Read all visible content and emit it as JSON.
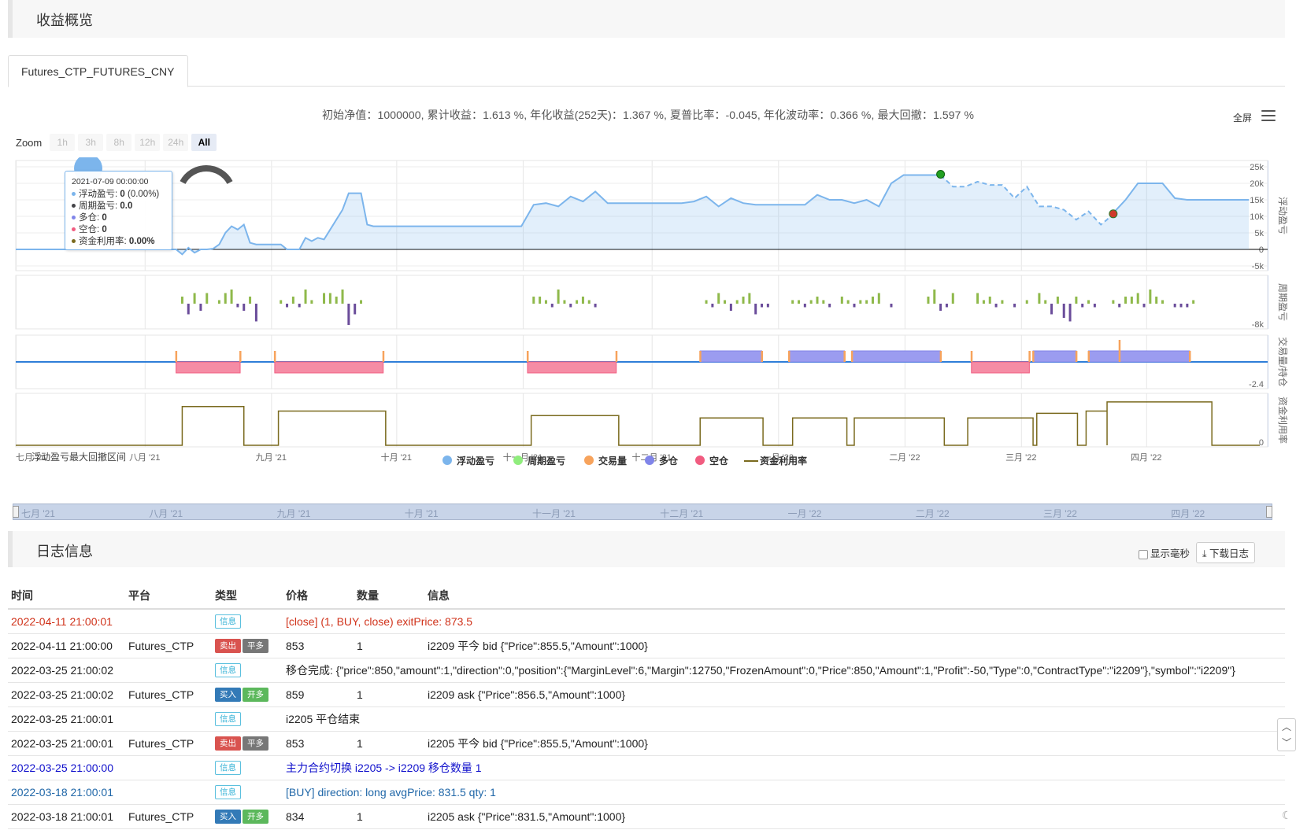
{
  "sections": {
    "overview_title": "收益概览",
    "log_title": "日志信息"
  },
  "tab": {
    "label": "Futures_CTP_FUTURES_CNY"
  },
  "summary_text": "初始净值：1000000, 累计收益：1.613 %, 年化收益(252天)：1.367 %, 夏普比率：-0.045, 年化波动率：0.366 %, 最大回撤：1.597 %",
  "toolbar": {
    "fullscreen": "全屏",
    "menu_icon": "hamburger-menu-icon"
  },
  "zoom": {
    "label": "Zoom",
    "buttons": [
      "1h",
      "3h",
      "8h",
      "12h",
      "24h",
      "All"
    ],
    "active": "All"
  },
  "tooltip": {
    "date": "2021-07-09 00:00:00",
    "rows": [
      {
        "label": "浮动盈亏: ",
        "value": "0",
        "extra": " (0.00%)",
        "color": "#7cb5ec"
      },
      {
        "label": "周期盈亏: ",
        "value": "0.0",
        "extra": "",
        "color": "#434348"
      },
      {
        "label": "多仓: ",
        "value": "0",
        "extra": "",
        "color": "#8085e9"
      },
      {
        "label": "空仓: ",
        "value": "0",
        "extra": "",
        "color": "#f15c80"
      },
      {
        "label": "资金利用率: ",
        "value": "0.00%",
        "extra": "",
        "color": "#7a6a1e"
      }
    ]
  },
  "chart_data": {
    "type": "line",
    "x_labels": [
      "七月 '21",
      "八月 '21",
      "九月 '21",
      "十月 '21",
      "十一月 '21",
      "十二月 '21",
      "一月 '22",
      "二月 '22",
      "三月 '22",
      "四月 '22"
    ],
    "annotation": "浮动盈亏最大回撤区间",
    "panels": [
      {
        "name": "浮动盈亏",
        "y_ticks": [
          "25k",
          "20k",
          "15k",
          "10k",
          "5k",
          "0",
          "-5k"
        ],
        "ylim": [
          -5000,
          25000
        ]
      },
      {
        "name": "周期盈亏",
        "y_ticks": [
          "-8k"
        ]
      },
      {
        "name": "交易量/持仓",
        "y_ticks": [
          "-2.4"
        ]
      },
      {
        "name": "资金利用率",
        "y_ticks": [
          "0"
        ]
      }
    ],
    "series_floating": {
      "name": "浮动盈亏",
      "x_frac": [
        0,
        0.13,
        0.135,
        0.14,
        0.145,
        0.15,
        0.155,
        0.16,
        0.165,
        0.17,
        0.175,
        0.18,
        0.185,
        0.19,
        0.195,
        0.2,
        0.205,
        0.21,
        0.215,
        0.22,
        0.225,
        0.23,
        0.235,
        0.24,
        0.245,
        0.25,
        0.255,
        0.26,
        0.265,
        0.27,
        0.275,
        0.28,
        0.285,
        0.29,
        0.3,
        0.31,
        0.32,
        0.33,
        0.34,
        0.35,
        0.36,
        0.37,
        0.38,
        0.39,
        0.4,
        0.41,
        0.42,
        0.43,
        0.44,
        0.45,
        0.46,
        0.47,
        0.48,
        0.49,
        0.5,
        0.51,
        0.52,
        0.53,
        0.54,
        0.55,
        0.56,
        0.57,
        0.58,
        0.59,
        0.6,
        0.61,
        0.62,
        0.63,
        0.64,
        0.65,
        0.66,
        0.67,
        0.68,
        0.69,
        0.7,
        0.71,
        0.72,
        0.73,
        0.74,
        0.75,
        0.76,
        0.77,
        0.78,
        0.79,
        0.8,
        0.81,
        0.82,
        0.83,
        0.84,
        0.85,
        0.86,
        0.87,
        0.88,
        0.885,
        0.89,
        0.9,
        0.91,
        0.92,
        0.93,
        0.94,
        0.95,
        0.96,
        0.97,
        0.98,
        0.99,
        1.0
      ],
      "y": [
        0,
        0,
        -1500,
        500,
        -1000,
        0,
        0,
        200,
        1500,
        5000,
        7000,
        6000,
        7500,
        2000,
        1500,
        1500,
        1500,
        1500,
        1500,
        0,
        0,
        0,
        3500,
        2500,
        3500,
        3000,
        6000,
        9000,
        12000,
        17000,
        17000,
        17000,
        7500,
        7000,
        7000,
        7000,
        7000,
        7000,
        7000,
        7000,
        7000,
        7000,
        7000,
        7000,
        7000,
        7000,
        13500,
        14000,
        13000,
        16000,
        14500,
        17500,
        14000,
        14000,
        14000,
        14000,
        14000,
        14000,
        14000,
        14500,
        16000,
        13000,
        15500,
        14000,
        13500,
        13500,
        13500,
        13500,
        13500,
        16500,
        15000,
        15000,
        14000,
        15000,
        13000,
        20000,
        22500,
        22500,
        22500,
        22500,
        19000,
        19000,
        20500,
        19500,
        19500,
        15500,
        19000,
        13000,
        13000,
        12000,
        9000,
        11500,
        7500,
        9000,
        11000,
        15000,
        20000,
        20000,
        20000,
        15500,
        15000,
        15000,
        15000,
        15000,
        15000,
        15000
      ],
      "dashed_from": 0.75,
      "dashed_to": 0.89,
      "max_marker": 0.745,
      "min_marker": 0.89
    },
    "series_period": {
      "name": "周期盈亏",
      "bars": [
        [
          0.135,
          2
        ],
        [
          0.14,
          -3
        ],
        [
          0.145,
          3
        ],
        [
          0.15,
          -2
        ],
        [
          0.155,
          3
        ],
        [
          0.165,
          1
        ],
        [
          0.17,
          3
        ],
        [
          0.175,
          4
        ],
        [
          0.18,
          -1
        ],
        [
          0.185,
          -2
        ],
        [
          0.19,
          2
        ],
        [
          0.195,
          -5
        ],
        [
          0.215,
          1
        ],
        [
          0.22,
          -1
        ],
        [
          0.225,
          2
        ],
        [
          0.23,
          -1
        ],
        [
          0.235,
          4
        ],
        [
          0.24,
          1
        ],
        [
          0.25,
          3
        ],
        [
          0.255,
          3
        ],
        [
          0.26,
          2
        ],
        [
          0.265,
          4
        ],
        [
          0.27,
          -6
        ],
        [
          0.275,
          -3
        ],
        [
          0.28,
          1
        ],
        [
          0.42,
          2
        ],
        [
          0.425,
          2
        ],
        [
          0.43,
          1
        ],
        [
          0.435,
          -1
        ],
        [
          0.44,
          4
        ],
        [
          0.445,
          1
        ],
        [
          0.45,
          -1
        ],
        [
          0.455,
          1
        ],
        [
          0.46,
          2
        ],
        [
          0.465,
          1
        ],
        [
          0.47,
          -1
        ],
        [
          0.56,
          1
        ],
        [
          0.565,
          -1
        ],
        [
          0.57,
          3
        ],
        [
          0.575,
          1
        ],
        [
          0.58,
          -2
        ],
        [
          0.585,
          1
        ],
        [
          0.59,
          2
        ],
        [
          0.595,
          3
        ],
        [
          0.6,
          -3
        ],
        [
          0.605,
          -1
        ],
        [
          0.61,
          -1
        ],
        [
          0.63,
          1
        ],
        [
          0.635,
          1
        ],
        [
          0.64,
          -1
        ],
        [
          0.645,
          1
        ],
        [
          0.65,
          2
        ],
        [
          0.655,
          1
        ],
        [
          0.66,
          -1
        ],
        [
          0.67,
          2
        ],
        [
          0.675,
          1
        ],
        [
          0.68,
          -1
        ],
        [
          0.685,
          1
        ],
        [
          0.69,
          1
        ],
        [
          0.695,
          2
        ],
        [
          0.7,
          3
        ],
        [
          0.71,
          -1
        ],
        [
          0.74,
          2
        ],
        [
          0.745,
          4
        ],
        [
          0.75,
          -2
        ],
        [
          0.755,
          -1
        ],
        [
          0.76,
          3
        ],
        [
          0.78,
          3
        ],
        [
          0.785,
          1
        ],
        [
          0.79,
          2
        ],
        [
          0.795,
          -1
        ],
        [
          0.8,
          1
        ],
        [
          0.81,
          -1
        ],
        [
          0.82,
          1
        ],
        [
          0.83,
          3
        ],
        [
          0.835,
          1
        ],
        [
          0.84,
          -3
        ],
        [
          0.845,
          2
        ],
        [
          0.85,
          -4
        ],
        [
          0.855,
          -5
        ],
        [
          0.86,
          2
        ],
        [
          0.865,
          -1
        ],
        [
          0.87,
          1
        ],
        [
          0.875,
          -1
        ],
        [
          0.89,
          1
        ],
        [
          0.895,
          -1
        ],
        [
          0.9,
          2
        ],
        [
          0.905,
          2
        ],
        [
          0.91,
          3
        ],
        [
          0.915,
          -1
        ],
        [
          0.92,
          4
        ],
        [
          0.925,
          2
        ],
        [
          0.93,
          1
        ],
        [
          0.94,
          -1
        ],
        [
          0.945,
          -1
        ],
        [
          0.95,
          -1
        ],
        [
          0.955,
          1
        ]
      ]
    },
    "series_position": {
      "long": [
        [
          0.555,
          0.605
        ],
        [
          0.627,
          0.672
        ],
        [
          0.678,
          0.75
        ],
        [
          0.825,
          0.86
        ],
        [
          0.87,
          0.952
        ]
      ],
      "short": [
        [
          0.13,
          0.182
        ],
        [
          0.21,
          0.298
        ],
        [
          0.415,
          0.487
        ],
        [
          0.775,
          0.822
        ]
      ],
      "trades": [
        0.13,
        0.182,
        0.21,
        0.298,
        0.415,
        0.487,
        0.555,
        0.605,
        0.627,
        0.672,
        0.678,
        0.75,
        0.775,
        0.822,
        0.825,
        0.86,
        0.87,
        0.895,
        0.952
      ]
    },
    "series_util": {
      "name": "资金利用率",
      "steps": [
        [
          0.135,
          0.185,
          0.85
        ],
        [
          0.213,
          0.3,
          0.75
        ],
        [
          0.418,
          0.489,
          0.65
        ],
        [
          0.555,
          0.606,
          0.6
        ],
        [
          0.63,
          0.674,
          0.6
        ],
        [
          0.68,
          0.753,
          0.6
        ],
        [
          0.772,
          0.825,
          0.6
        ],
        [
          0.828,
          0.861,
          0.7
        ],
        [
          0.868,
          0.885,
          0.75
        ],
        [
          0.885,
          0.97,
          0.95
        ]
      ]
    },
    "legend": [
      {
        "name": "浮动盈亏",
        "color": "#7cb5ec",
        "shape": "circle"
      },
      {
        "name": "周期盈亏",
        "color": "#90ed7d",
        "shape": "circle"
      },
      {
        "name": "交易量",
        "color": "#f7a35c",
        "shape": "circle"
      },
      {
        "name": "多仓",
        "color": "#8085e9",
        "shape": "circle"
      },
      {
        "name": "空仓",
        "color": "#f15c80",
        "shape": "circle"
      },
      {
        "name": "资金利用率",
        "color": "#7a6a1e",
        "shape": "line"
      }
    ]
  },
  "navigator": {
    "labels": [
      "七月 '21",
      "八月 '21",
      "九月 '21",
      "十月 '21",
      "十一月 '21",
      "十二月 '21",
      "一月 '22",
      "二月 '22",
      "三月 '22",
      "四月 '22"
    ]
  },
  "log_tools": {
    "show_ms": "显示毫秒",
    "download": "下载日志"
  },
  "log": {
    "headers": [
      "时间",
      "平台",
      "类型",
      "价格",
      "数量",
      "信息"
    ],
    "rows": [
      {
        "time": "2022-04-11 21:00:01",
        "platform": "",
        "badges": [
          "信息"
        ],
        "badge_kinds": [
          "info"
        ],
        "price": "[close] (1, BUY, close) exitPrice: 873.5",
        "qty": "",
        "msg": "",
        "color": "red",
        "price_span": true
      },
      {
        "time": "2022-04-11 21:00:00",
        "platform": "Futures_CTP",
        "badges": [
          "卖出",
          "平多"
        ],
        "badge_kinds": [
          "sell",
          "close"
        ],
        "price": "853",
        "qty": "1",
        "msg": "i2209 平今 bid {\"Price\":855.5,\"Amount\":1000}",
        "color": "",
        "price_span": false
      },
      {
        "time": "2022-03-25 21:00:02",
        "platform": "",
        "badges": [
          "信息"
        ],
        "badge_kinds": [
          "info"
        ],
        "price": "移仓完成: {\"price\":850,\"amount\":1,\"direction\":0,\"position\":{\"MarginLevel\":6,\"Margin\":12750,\"FrozenAmount\":0,\"Price\":850,\"Amount\":1,\"Profit\":-50,\"Type\":0,\"ContractType\":\"i2209\"},\"symbol\":\"i2209\"}",
        "qty": "",
        "msg": "",
        "color": "",
        "price_span": true
      },
      {
        "time": "2022-03-25 21:00:02",
        "platform": "Futures_CTP",
        "badges": [
          "买入",
          "开多"
        ],
        "badge_kinds": [
          "buy",
          "open"
        ],
        "price": "859",
        "qty": "1",
        "msg": "i2209 ask {\"Price\":856.5,\"Amount\":1000}",
        "color": "",
        "price_span": false
      },
      {
        "time": "2022-03-25 21:00:01",
        "platform": "",
        "badges": [
          "信息"
        ],
        "badge_kinds": [
          "info"
        ],
        "price": "i2205 平仓结束",
        "qty": "",
        "msg": "",
        "color": "",
        "price_span": true
      },
      {
        "time": "2022-03-25 21:00:01",
        "platform": "Futures_CTP",
        "badges": [
          "卖出",
          "平多"
        ],
        "badge_kinds": [
          "sell",
          "close"
        ],
        "price": "853",
        "qty": "1",
        "msg": "i2205 平今 bid {\"Price\":855.5,\"Amount\":1000}",
        "color": "",
        "price_span": false
      },
      {
        "time": "2022-03-25 21:00:00",
        "platform": "",
        "badges": [
          "信息"
        ],
        "badge_kinds": [
          "info"
        ],
        "price": "主力合约切换 i2205 -> i2209 移仓数量 1",
        "qty": "",
        "msg": "",
        "color": "blue",
        "price_span": true
      },
      {
        "time": "2022-03-18 21:00:01",
        "platform": "",
        "badges": [
          "信息"
        ],
        "badge_kinds": [
          "info"
        ],
        "price": "[BUY] direction: long avgPrice: 831.5 qty: 1",
        "qty": "",
        "msg": "",
        "color": "teal",
        "price_span": true
      },
      {
        "time": "2022-03-18 21:00:01",
        "platform": "Futures_CTP",
        "badges": [
          "买入",
          "开多"
        ],
        "badge_kinds": [
          "buy",
          "open"
        ],
        "price": "834",
        "qty": "1",
        "msg": "i2205 ask {\"Price\":831.5,\"Amount\":1000}",
        "color": "",
        "price_span": false
      }
    ]
  }
}
